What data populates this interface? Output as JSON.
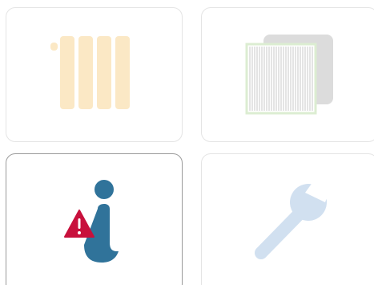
{
  "tiles": [
    {
      "id": "heating",
      "icon": "radiator-icon",
      "selected": false,
      "color": "#fbe8c5"
    },
    {
      "id": "filter",
      "icon": "air-filter-icon",
      "selected": false,
      "color": "#dcedd2"
    },
    {
      "id": "info",
      "icon": "info-warning-icon",
      "selected": true,
      "color": "#30739a",
      "warning_color": "#c8103c"
    },
    {
      "id": "service",
      "icon": "wrench-icon",
      "selected": false,
      "color": "#d1e0f0"
    }
  ]
}
